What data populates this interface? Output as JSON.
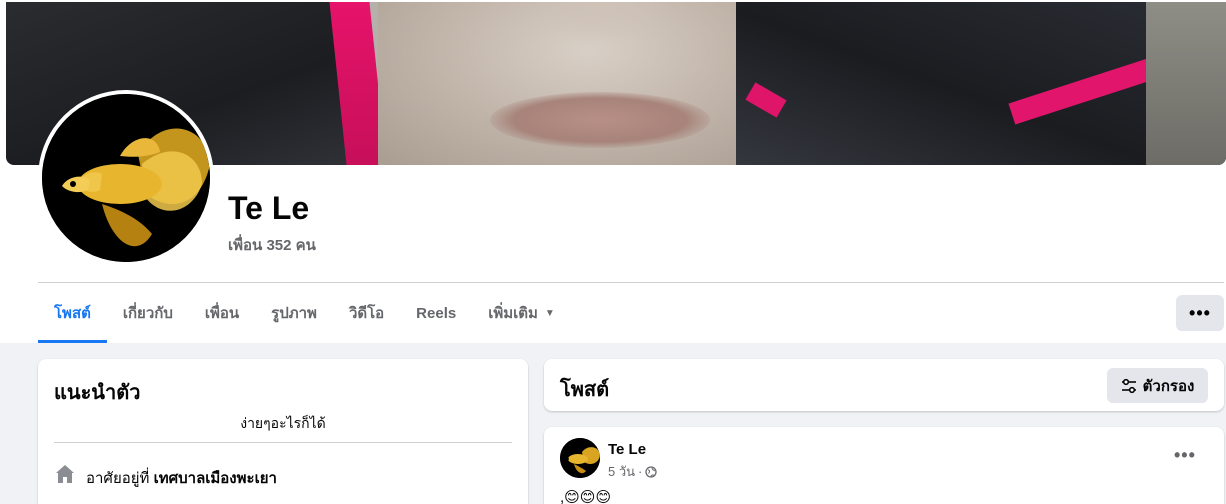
{
  "profile": {
    "name": "Te Le",
    "friends_text": "เพื่อน 352 คน"
  },
  "tabs": [
    {
      "label": "โพสต์",
      "active": true
    },
    {
      "label": "เกี่ยวกับ",
      "active": false
    },
    {
      "label": "เพื่อน",
      "active": false
    },
    {
      "label": "รูปภาพ",
      "active": false
    },
    {
      "label": "วิดีโอ",
      "active": false
    },
    {
      "label": "Reels",
      "active": false
    },
    {
      "label": "เพิ่มเติม",
      "active": false
    }
  ],
  "more_button": {
    "icon": "ellipsis-icon",
    "label": "•••"
  },
  "intro": {
    "title": "แนะนำตัว",
    "bio": "ง่ายๆอะไรก็ได้",
    "lives_prefix": "อาศัยอยู่ที่",
    "lives_place": "เทศบาลเมืองพะเยา"
  },
  "posts_section": {
    "title": "โพสต์",
    "filter_label": "ตัวกรอง"
  },
  "post": {
    "author": "Te Le",
    "time": "5 วัน",
    "separator": "·",
    "more_label": "•••",
    "text": ",😊😊😊"
  },
  "colors": {
    "accent": "#1877f2",
    "background": "#f0f2f5",
    "secondary_text": "#65676b",
    "button_bg": "#e4e6eb"
  }
}
